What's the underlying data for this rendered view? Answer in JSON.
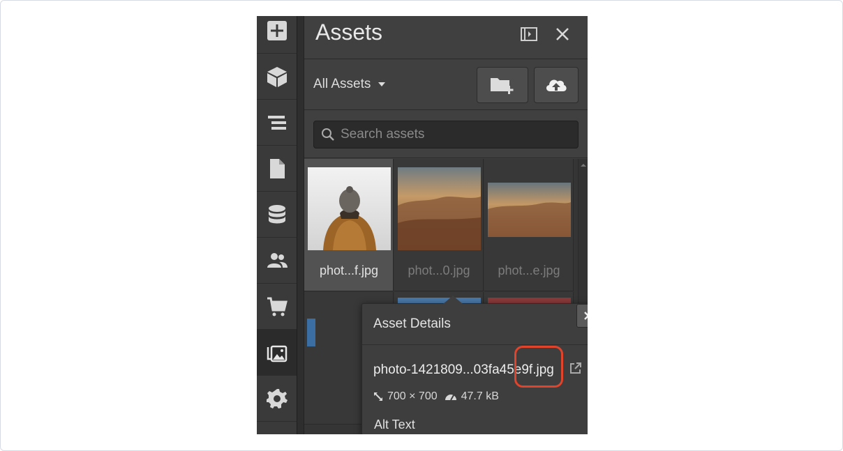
{
  "panel": {
    "title": "Assets",
    "filter_label": "All Assets",
    "search_placeholder": "Search assets"
  },
  "rail": [
    "add-icon",
    "box-icon",
    "navigator-icon",
    "pages-icon",
    "cms-icon",
    "users-icon",
    "cart-icon",
    "assets-icon",
    "settings-icon"
  ],
  "assets": [
    {
      "name": "phot...f.jpg",
      "selected": true
    },
    {
      "name": "phot...0.jpg",
      "selected": false
    },
    {
      "name": "phot...e.jpg",
      "selected": false
    }
  ],
  "details": {
    "title": "Asset Details",
    "filename": "photo-1421809...03fa45e9f.jpg",
    "dimensions": "700 × 700",
    "size": "47.7 kB",
    "alt_label": "Alt Text"
  },
  "colors": {
    "panel_bg": "#404040",
    "highlight": "#e2442b"
  }
}
